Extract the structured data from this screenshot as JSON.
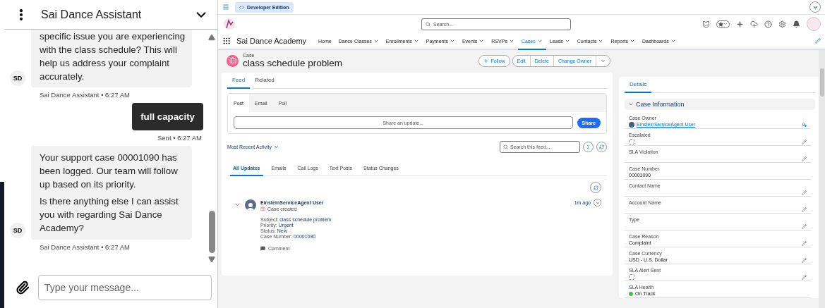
{
  "chat": {
    "title": "Sai Dance Assistant",
    "messages": [
      {
        "kind": "bot",
        "avatar": "SD",
        "paragraphs": [
          "specific issue you are experiencing with the class schedule? This will help us address your complaint accurately."
        ],
        "meta": "Sai Dance Assistant • 6:27 AM"
      },
      {
        "kind": "user",
        "paragraphs": [
          "full capacity"
        ],
        "meta": "Sent • 6:27 AM"
      },
      {
        "kind": "bot",
        "avatar": "SD",
        "paragraphs": [
          "Your support case 00001090 has been logged. Our team will follow up based on its priority.",
          "Is there anything else I can assist you with regarding Sai Dance Academy?"
        ],
        "meta": "Sai Dance Assistant • 6:27 AM"
      }
    ],
    "input": {
      "placeholder": "Type your message..."
    }
  },
  "top_bar": {
    "badge": "Developer Edition"
  },
  "global_header": {
    "search": {
      "placeholder": "Search..."
    }
  },
  "app": {
    "name": "Sai Dance Academy",
    "nav": [
      {
        "label": "Home",
        "has_menu": false,
        "selected": false
      },
      {
        "label": "Dance Classes",
        "has_menu": true,
        "selected": false
      },
      {
        "label": "Enrollments",
        "has_menu": true,
        "selected": false
      },
      {
        "label": "Payments",
        "has_menu": true,
        "selected": false
      },
      {
        "label": "Events",
        "has_menu": true,
        "selected": false
      },
      {
        "label": "RSVPs",
        "has_menu": true,
        "selected": false
      },
      {
        "label": "Cases",
        "has_menu": true,
        "selected": true
      },
      {
        "label": "Leads",
        "has_menu": true,
        "selected": false
      },
      {
        "label": "Contacts",
        "has_menu": true,
        "selected": false
      },
      {
        "label": "Reports",
        "has_menu": true,
        "selected": false
      },
      {
        "label": "Dashboards",
        "has_menu": true,
        "selected": false
      }
    ]
  },
  "record": {
    "type": "Case",
    "title": "class schedule problem",
    "follow": "Follow",
    "actions": [
      "Edit",
      "Delete",
      "Change Owner"
    ]
  },
  "feed": {
    "tabs": [
      {
        "label": "Feed",
        "selected": true
      },
      {
        "label": "Related",
        "selected": false
      }
    ],
    "publisher": {
      "tabs": [
        {
          "label": "Post",
          "selected": true
        },
        {
          "label": "Email",
          "selected": false
        },
        {
          "label": "Poll",
          "selected": false
        }
      ],
      "placeholder": "Share an update...",
      "button": "Share"
    },
    "sort": "Most Recent Activity",
    "search": {
      "placeholder": "Search this feed..."
    },
    "filters": [
      {
        "label": "All Updates",
        "selected": true
      },
      {
        "label": "Emails",
        "selected": false
      },
      {
        "label": "Call Logs",
        "selected": false
      },
      {
        "label": "Text Posts",
        "selected": false
      },
      {
        "label": "Status Changes",
        "selected": false
      }
    ],
    "post": {
      "author": "EinsteinServiceAgent User",
      "action": "Case created",
      "time": "1m ago",
      "fields": [
        {
          "label": "Subject:",
          "value": "class schedule problem"
        },
        {
          "label": "Priority:",
          "value": "Urgent"
        },
        {
          "label": "Status:",
          "value": "New"
        },
        {
          "label": "Case Number:",
          "value": "00001090"
        }
      ],
      "comment": "Comment"
    }
  },
  "details": {
    "tab": {
      "label": "Details",
      "selected": true
    },
    "section": {
      "title": "Case Information",
      "expanded": true
    },
    "fields": [
      {
        "label": "Case Owner",
        "kind": "owner",
        "value": "EinsteinServiceAgent User"
      },
      {
        "label": "Escalated",
        "kind": "checkbox",
        "checked": false,
        "editable": true
      },
      {
        "label": "SLA Violation",
        "kind": "text",
        "editable": true
      },
      {
        "label": "Case Number",
        "kind": "text",
        "value": "00001090",
        "editable": false
      },
      {
        "label": "Contact Name",
        "kind": "text",
        "editable": true
      },
      {
        "label": "Account Name",
        "kind": "text",
        "editable": true
      },
      {
        "label": "Type",
        "kind": "text",
        "editable": true
      },
      {
        "label": "Case Reason",
        "kind": "text",
        "value": "Complaint",
        "editable": true
      },
      {
        "label": "Case Currency",
        "kind": "text",
        "value": "USD - U.S. Dollar",
        "editable": true
      },
      {
        "label": "SLA Alert Sent",
        "kind": "checkbox",
        "checked": false,
        "editable": true
      },
      {
        "label": "SLA Health",
        "kind": "status",
        "value": "On Track",
        "color": "#4bbf4b",
        "editable": false
      }
    ]
  }
}
